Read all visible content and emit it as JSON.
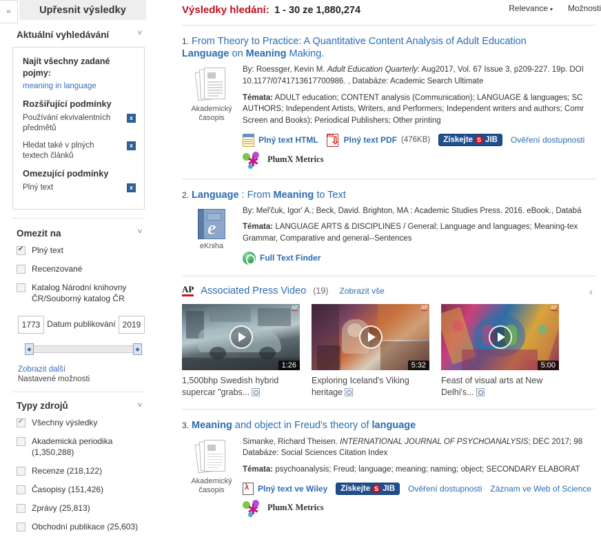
{
  "sidebar": {
    "collapse_icon": "chevron-double-left-icon",
    "title": "Upřesnit výsledky",
    "current_search": {
      "heading": "Aktuální vyhledávání",
      "chevron": "˅",
      "find_all_label": "Najít všechny zadané pojmy:",
      "query_term": "meaning in language",
      "expanders_heading": "Rozšiřující podmínky",
      "expanders": [
        {
          "label": "Používání ekvivalentních předmětů",
          "remove": "x"
        },
        {
          "label": "Hledat také v plných textech článků",
          "remove": "x"
        }
      ],
      "limiters_heading": "Omezující podmínky",
      "limiters": [
        {
          "label": "Plný text",
          "remove": "x"
        }
      ]
    },
    "limit_to": {
      "heading": "Omezit na",
      "chevron": "˅",
      "items": [
        {
          "label": "Plný text",
          "checked": true
        },
        {
          "label": "Recenzované",
          "checked": false
        },
        {
          "label": "Katalog Národní knihovny ČR/Souborný katalog ČR",
          "checked": false
        }
      ],
      "date_from": "1773",
      "date_to": "2019",
      "date_caption": "Datum publikování",
      "show_more": "Zobrazit další",
      "set_options": "Nastavené možnosti"
    },
    "source_types": {
      "heading": "Typy zdrojů",
      "chevron": "˅",
      "items": [
        {
          "label": "Všechny výsledky",
          "checked": true
        },
        {
          "label": "Akademická periodika (1,350,288)",
          "checked": false
        },
        {
          "label": "Recenze (218,122)",
          "checked": false
        },
        {
          "label": "Časopisy (151,426)",
          "checked": false
        },
        {
          "label": "Zprávy (25,813)",
          "checked": false
        },
        {
          "label": "Obchodní publikace (25,603)",
          "checked": false
        }
      ]
    }
  },
  "header": {
    "results_label": "Výsledky hledání:",
    "results_range": "1 - 30 ze 1,880,274",
    "sort_label": "Relevance",
    "sort_caret": "▾",
    "options_label": "Možnosti"
  },
  "results": [
    {
      "number": "1.",
      "title_parts": [
        {
          "text": "From Theory to Practice: A Quantitative Content Analysis of Adult Education",
          "bold": false
        },
        {
          "text": "Language",
          "bold": true
        },
        {
          "text": " on ",
          "bold": false
        },
        {
          "text": "Meaning",
          "bold": true
        },
        {
          "text": " Making.",
          "bold": false
        }
      ],
      "icon": "academic-journal-icon",
      "icon_caption": "Akademický časopis",
      "meta_prefix": "By: ",
      "author": "Roessger, Kevin M. ",
      "source_italic": "Adult Education Quarterly",
      "meta_rest": ": Aug2017, Vol. 67 Issue 3, p209-227. 19p. DOI",
      "meta_line2": "10.1177/0741713617700986. , Databáze: Academic Search Ultimate",
      "subjects_label": "Témata:",
      "subject_lines": [
        "ADULT education; CONTENT analysis (Communication); LANGUAGE & languages; SC",
        "AUTHORS; Independent Artists, Writers, and Performers; Independent writers and authors; Comr",
        "Screen and Books); Periodical Publishers; Other printing"
      ],
      "subjects_bold": "LANGUAGE & languages",
      "links": [
        {
          "icon": "html-document-icon",
          "label": "Plný text HTML"
        },
        {
          "icon": "pdf-document-icon",
          "label": "Plný text PDF",
          "size": "(476KB)"
        }
      ],
      "jib_badge": {
        "text1": "Získejte",
        "mark": "S",
        "text2": "JIB"
      },
      "availability_label": "Ověření dostupnosti",
      "plumx_label": "PlumX Metrics",
      "plumx_icon": "plumx-icon"
    },
    {
      "number": "2.",
      "title_parts": [
        {
          "text": "Language",
          "bold": true
        },
        {
          "text": " : From ",
          "bold": false
        },
        {
          "text": "Meaning",
          "bold": true
        },
        {
          "text": " to Text",
          "bold": false
        }
      ],
      "icon": "ebook-icon",
      "icon_caption": "eKniha",
      "meta_line": "By: Mel'čuk, Igor' A.; Beck, David. Brighton, MA : Academic Studies Press. 2016. eBook., Databá",
      "subjects_label": "Témata:",
      "subject_lines": [
        "LANGUAGE ARTS & DISCIPLINES / General; Language and languages; Meaning-tex",
        "Grammar, Comparative and general--Sentences"
      ],
      "full_text_finder": {
        "icon": "full-text-finder-icon",
        "label": "Full Text Finder"
      }
    },
    {
      "number": "3.",
      "title_parts": [
        {
          "text": "Meaning",
          "bold": true
        },
        {
          "text": " and object in Freud's theory of ",
          "bold": false
        },
        {
          "text": "language",
          "bold": true
        }
      ],
      "icon": "academic-journal-icon",
      "icon_caption": "Akademický časopis",
      "author": "Simanke, Richard Theisen. ",
      "source_italic": "INTERNATIONAL JOURNAL OF PSYCHOANALYSIS",
      "meta_rest": "; DEC 2017; 98",
      "meta_line2": "Databáze: Social Sciences Citation Index",
      "subjects_label": "Témata:",
      "subject_lines": [
        "psychoanalysis; Freud; language; meaning; naming; object; SECONDARY ELABORAT"
      ],
      "links": [
        {
          "icon": "wiley-pdf-icon",
          "label": "Plný text ve Wiley"
        }
      ],
      "jib_badge": {
        "text1": "Získejte",
        "mark": "S",
        "text2": "JIB"
      },
      "availability_label": "Ověření dostupnosti",
      "wos_label": "Záznam ve Web of Science",
      "plumx_label": "PlumX Metrics",
      "plumx_icon": "plumx-icon"
    }
  ],
  "ap_carousel": {
    "logo": "AP",
    "title": "Associated Press Video",
    "count": "(19)",
    "show_all": "Zobrazit vše",
    "prev_arrow": "‹",
    "videos": [
      {
        "caption": "1,500bhp Swedish hybrid supercar \"grabs...",
        "duration": "1:26",
        "preview_icon": "preview-icon"
      },
      {
        "caption": "Exploring Iceland's Viking heritage",
        "duration": "5:32",
        "preview_icon": "preview-icon"
      },
      {
        "caption": "Feast of visual arts at New Delhi's...",
        "duration": "5:00",
        "preview_icon": "preview-icon"
      }
    ]
  },
  "colors": {
    "results_red": "#bb1122",
    "link_blue": "#2b6cb0",
    "jib_blue": "#1f4e8c",
    "ap_red": "#cc1122"
  }
}
